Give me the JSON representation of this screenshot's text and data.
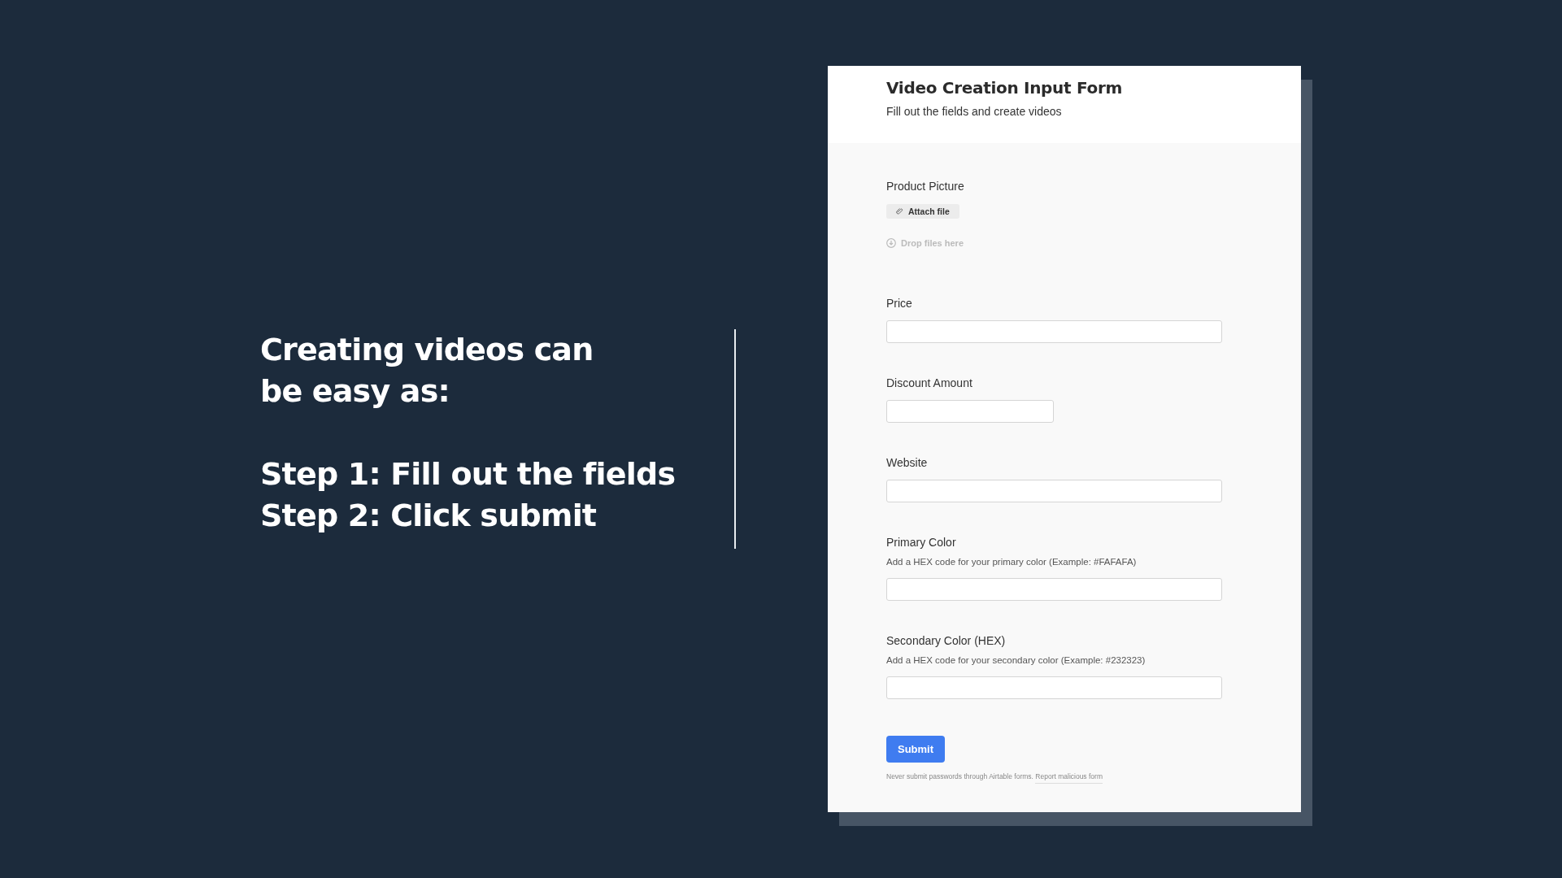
{
  "promo": {
    "headline": "Creating videos can be easy as:",
    "steps": [
      "Step 1: Fill out the fields",
      "Step 2: Click submit"
    ]
  },
  "form": {
    "title": "Video Creation Input Form",
    "subtitle": "Fill out the fields and create videos",
    "fields": [
      {
        "kind": "attachment",
        "label": "Product Picture",
        "button": "Attach file",
        "drop_hint": "Drop files here"
      },
      {
        "kind": "text",
        "label": "Price"
      },
      {
        "kind": "short_text",
        "label": "Discount Amount"
      },
      {
        "kind": "text",
        "label": "Website"
      },
      {
        "kind": "text",
        "label": "Primary Color",
        "help": "Add a HEX code for your primary color (Example: #FAFAFA)"
      },
      {
        "kind": "text",
        "label": "Secondary Color (HEX)",
        "help": "Add a HEX code for your secondary color (Example: #232323)"
      }
    ],
    "submit": "Submit",
    "footer": {
      "note": "Never submit passwords through Airtable forms.",
      "link": "Report malicious form"
    }
  }
}
